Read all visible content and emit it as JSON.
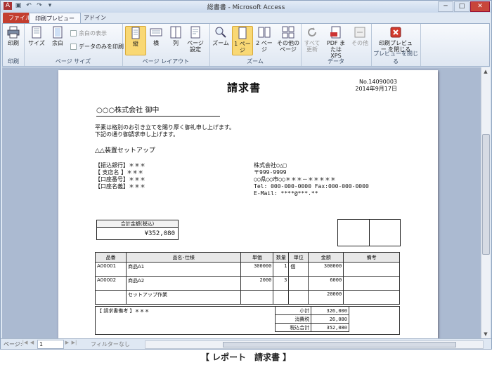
{
  "window": {
    "title": "総書書 - Microsoft Access"
  },
  "tabs": {
    "file": "ファイル",
    "print_preview": "印刷プレビュー",
    "addin": "アドイン"
  },
  "ribbon": {
    "print_label": "印刷",
    "group_print": "印刷",
    "size_label": "サイズ",
    "margin_label": "余白",
    "show_margin": "余白の表示",
    "data_only": "データのみを印刷",
    "group_pagesize": "ページ サイズ",
    "portrait": "縦",
    "landscape": "横",
    "columns": "列",
    "page_setup": "ページ 設定",
    "group_layout": "ページ レイアウト",
    "zoom": "ズーム",
    "one_page": "1 ページ",
    "two_page": "2 ページ",
    "more_pages": "その他の ページ",
    "group_zoom": "ズーム",
    "refresh_all": "すべて 更新",
    "pdf_xps": "PDF または XPS",
    "other": "その他",
    "group_data": "データ",
    "close_preview": "印刷プレビュー を閉じる",
    "group_close": "プレビューを閉じる"
  },
  "invoice": {
    "title": "請求書",
    "number": "No.14090003",
    "date": "2014年9月17日",
    "customer": "○○○株式会社 御中",
    "greeting1": "平素は格別のお引き立てを賜り厚く御礼申し上げます。",
    "greeting2": "下記の通り御請求申し上げます。",
    "subject": "△△装置セットアップ",
    "bank1": "【振込銀行】＊＊＊",
    "bank2": "【 支店名 】＊＊＊",
    "bank3": "【口座番号】＊＊＊",
    "bank4": "【口座名義】＊＊＊",
    "company1": "株式会社○△□",
    "company2": "〒999-9999",
    "company3": "○○県○○市○○＊＊＊－＊＊＊＊＊",
    "company4": "Tel: 000-000-0000  Fax:000-000-0000",
    "company5": "E-Mail: ****@***.**",
    "total_label": "合計金額(税込)",
    "total_value": "¥352,080",
    "headers": [
      "品番",
      "品名･仕様",
      "単価",
      "数量",
      "単位",
      "金額",
      "備考"
    ],
    "rows": [
      [
        "A00001",
        "商品A1",
        "300000",
        "1",
        "個",
        "300000",
        ""
      ],
      [
        "A00002",
        "商品A2",
        "2000",
        "3",
        "",
        "6000",
        ""
      ],
      [
        "",
        "セットアップ作業",
        "",
        "",
        "",
        "20000",
        ""
      ]
    ],
    "remark_label": "【 請求書備考 】＊＊＊",
    "subtotal_label": "小計",
    "subtotal": "326,000",
    "tax_label": "消費税",
    "tax": "26,080",
    "grand_label": "税込合計",
    "grand": "352,080"
  },
  "status": {
    "page_label": "ページ:",
    "page_value": "1",
    "filter": "フィルターなし"
  },
  "caption": "【 レポート　請求書 】"
}
